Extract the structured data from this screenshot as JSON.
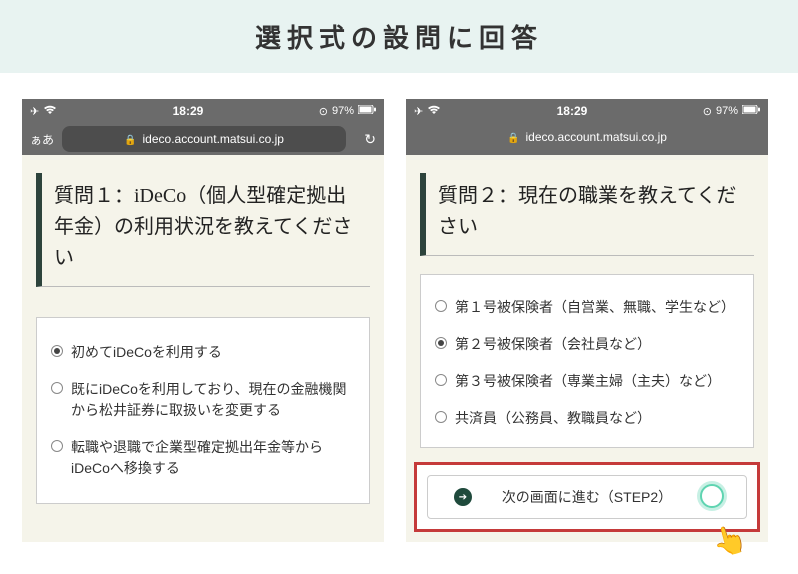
{
  "header": {
    "title": "選択式の設問に回答"
  },
  "left": {
    "statusbar": {
      "time": "18:29",
      "battery": "97%"
    },
    "addressbar": {
      "mode": "ぁあ",
      "url": "ideco.account.matsui.co.jp"
    },
    "question_title": "質問１：iDeCo（個人型確定拠出年金）の利用状況を教えてください",
    "options": [
      {
        "label": "初めてiDeCoを利用する",
        "selected": true
      },
      {
        "label": "既にiDeCoを利用しており、現在の金融機関から松井証券に取扱いを変更する",
        "selected": false
      },
      {
        "label": "転職や退職で企業型確定拠出年金等からiDeCoへ移換する",
        "selected": false
      }
    ]
  },
  "right": {
    "statusbar": {
      "time": "18:29",
      "battery": "97%"
    },
    "addressbar": {
      "url": "ideco.account.matsui.co.jp"
    },
    "question_title": "質問２：現在の職業を教えてください",
    "options": [
      {
        "label": "第１号被保険者（自営業、無職、学生など）",
        "selected": false
      },
      {
        "label": "第２号被保険者（会社員など）",
        "selected": true
      },
      {
        "label": "第３号被保険者（専業主婦（主夫）など）",
        "selected": false
      },
      {
        "label": "共済員（公務員、教職員など）",
        "selected": false
      }
    ],
    "next_button": "次の画面に進む（STEP2）"
  }
}
